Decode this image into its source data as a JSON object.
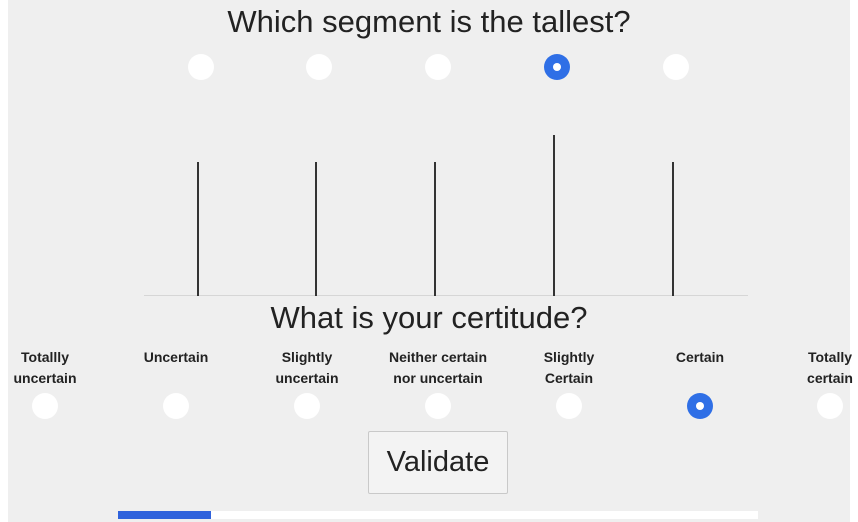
{
  "question_title": "Which segment is the tallest?",
  "segment_choices": [
    {
      "id": "segment-1",
      "selected": false,
      "relative_height": 0.83
    },
    {
      "id": "segment-2",
      "selected": false,
      "relative_height": 0.83
    },
    {
      "id": "segment-3",
      "selected": false,
      "relative_height": 0.83
    },
    {
      "id": "segment-4",
      "selected": true,
      "relative_height": 1.0
    },
    {
      "id": "segment-5",
      "selected": false,
      "relative_height": 0.83
    }
  ],
  "certitude_title": "What is your certitude?",
  "certitude_options": [
    {
      "line1": "Totallly",
      "line2": "uncertain",
      "selected": false
    },
    {
      "line1": "Uncertain",
      "line2": "",
      "selected": false
    },
    {
      "line1": "Slightly",
      "line2": "uncertain",
      "selected": false
    },
    {
      "line1": "Neither certain",
      "line2": "nor uncertain",
      "selected": false
    },
    {
      "line1": "Slightly",
      "line2": "Certain",
      "selected": false
    },
    {
      "line1": "Certain",
      "line2": "",
      "selected": true
    },
    {
      "line1": "Totally",
      "line2": "certain",
      "selected": false
    }
  ],
  "validate_label": "Validate",
  "progress_fraction": 0.145,
  "colors": {
    "accent": "#2f6fe6",
    "progress": "#2f62dc",
    "panel_background": "#efefef",
    "segment_line": "#333333"
  }
}
